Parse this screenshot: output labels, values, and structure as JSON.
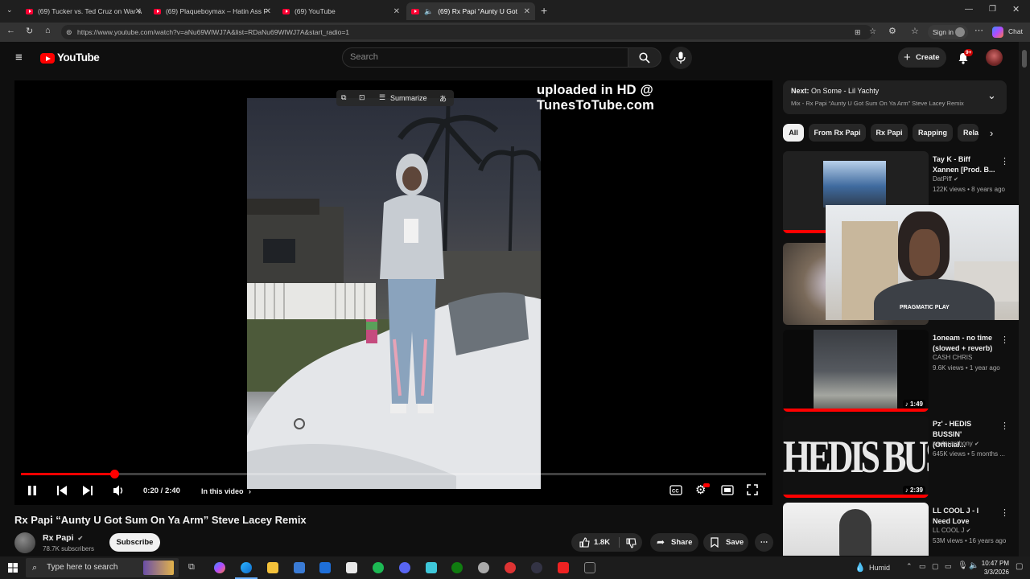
{
  "browser": {
    "tabs": [
      {
        "title": "(69) Tucker vs. Ted Cruz on War wi"
      },
      {
        "title": "(69) Plaqueboymax – Hatin Ass F"
      },
      {
        "title": "(69) YouTube"
      },
      {
        "title": "(69) Rx Papi “Aunty U Got Sum"
      }
    ],
    "new_tab": "+",
    "url": "https://www.youtube.com/watch?v=aNu69WIWJ7A&list=RDaNu69WIWJ7A&start_radio=1",
    "sign_in_label": "Sign in",
    "chat_label": "Chat"
  },
  "youtube": {
    "logo_text": "YouTube",
    "search_placeholder": "Search",
    "create_label": "Create",
    "notification_badge": "9+"
  },
  "player": {
    "watermark": "uploaded in HD @ TunesToTube.com",
    "summarize_label": "Summarize",
    "time_current": "0:20",
    "time_sep": "/",
    "time_total": "2:40",
    "chapter_label": "In this video",
    "progress_fraction": 0.125
  },
  "video": {
    "title": "Rx Papi “Aunty U Got Sum On Ya Arm” Steve Lacey Remix",
    "channel_name": "Rx Papi",
    "subscribers": "78.7K subscribers",
    "subscribe_label": "Subscribe",
    "like_count": "1.8K",
    "share_label": "Share",
    "save_label": "Save"
  },
  "sidebar": {
    "next_prefix": "Next:",
    "next_title": "On Some - Lil Yachty",
    "next_sub": "Mix - Rx Papi “Aunty U Got Sum On Ya Arm” Steve Lacey Remix",
    "chips": [
      "All",
      "From Rx Papi",
      "Rx Papi",
      "Rapping",
      "Rela"
    ],
    "recs": [
      {
        "title": "Tay K - Biff Xannen [Prod. B...",
        "channel": "DatPiff",
        "meta": "122K views • 8 years ago",
        "duration": ""
      },
      {
        "title": "",
        "channel": "",
        "meta": "",
        "duration": ""
      },
      {
        "title": "1oneam - no time (slowed + reverb)",
        "channel": "CASH CHRIS",
        "meta": "9.6K views • 1 year ago",
        "duration": "1:49"
      },
      {
        "title": "Pz' - HEDIS BUSSIN' (Official...",
        "channel": "xavieranthony",
        "meta": "645K views • 5 months ...",
        "duration": "2:39"
      },
      {
        "title": "LL COOL J - I Need Love",
        "channel": "LL COOL J",
        "meta": "53M views • 16 years ago",
        "duration": ""
      }
    ],
    "rec2_thumb_text": "HEDIS BUSSIN"
  },
  "webcam": {
    "logo_text": "PRAGMATIC PLAY"
  },
  "taskbar": {
    "search_placeholder": "Type here to search",
    "weather": "Humid",
    "time": "10:47 PM",
    "date": "3/3/2026"
  },
  "colors": {
    "accent_red": "#ff0000",
    "background": "#0f0f0f"
  }
}
